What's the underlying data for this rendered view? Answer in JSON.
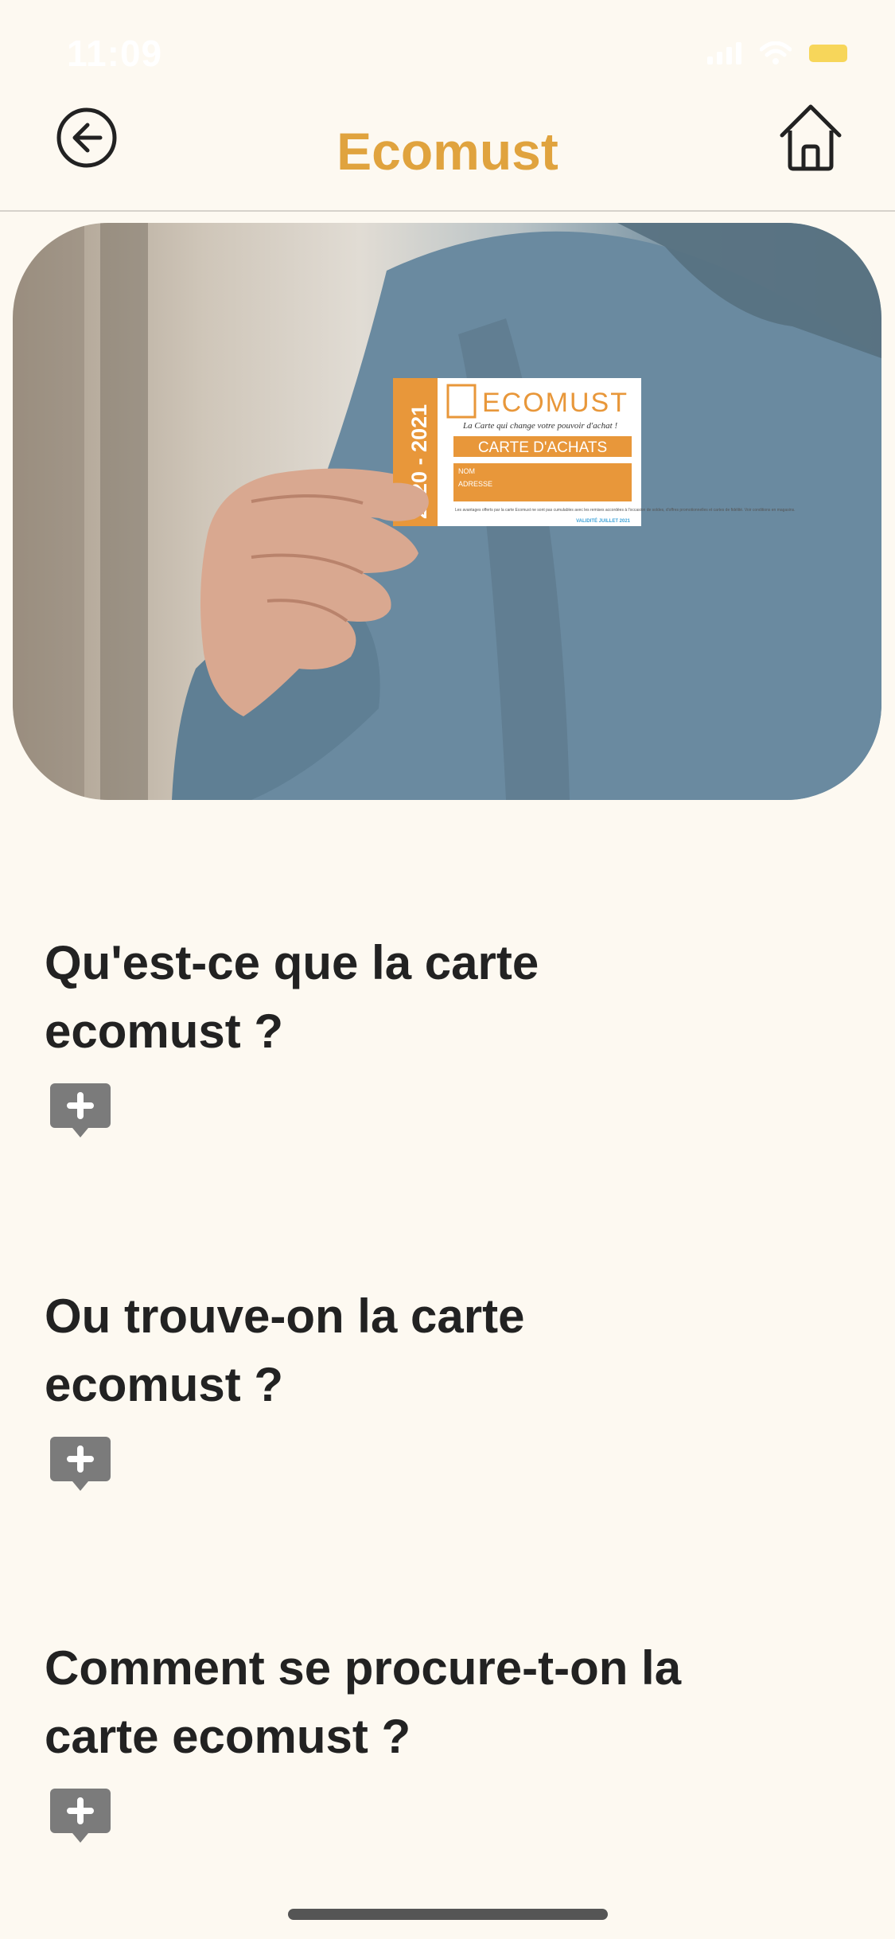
{
  "status_bar": {
    "time": "11:09"
  },
  "nav": {
    "title": "Ecomust"
  },
  "hero_card": {
    "years": "2020 - 2021",
    "brand": "ECOMUST",
    "tagline": "La Carte qui change votre pouvoir d'achat !",
    "label": "CARTE D'ACHATS",
    "field_name": "NOM",
    "field_address": "ADRESSE",
    "fine_print": "Les avantages offerts par la carte Ecomust ne sont pas cumulables avec les remises accordées à l'occasion de soldes, d'offres promotionnelles et cartes de fidélité. Voir conditions en magasins.",
    "validity": "VALIDITÉ JUILLET 2021"
  },
  "faq": [
    {
      "line1": "Qu'est-ce que la carte",
      "line2": "ecomust ?"
    },
    {
      "line1": "Ou trouve-on la carte",
      "line2": "ecomust ?"
    },
    {
      "line1": "Comment se procure-t-on la",
      "line2": "carte ecomust ?"
    }
  ],
  "colors": {
    "accent": "#e0a33e",
    "background": "#fdf9f1",
    "text": "#222222",
    "toggle": "#7b7b7b"
  },
  "icons": [
    "back-arrow-icon",
    "home-icon",
    "signal-icon",
    "wifi-icon",
    "battery-icon",
    "plus-icon"
  ]
}
